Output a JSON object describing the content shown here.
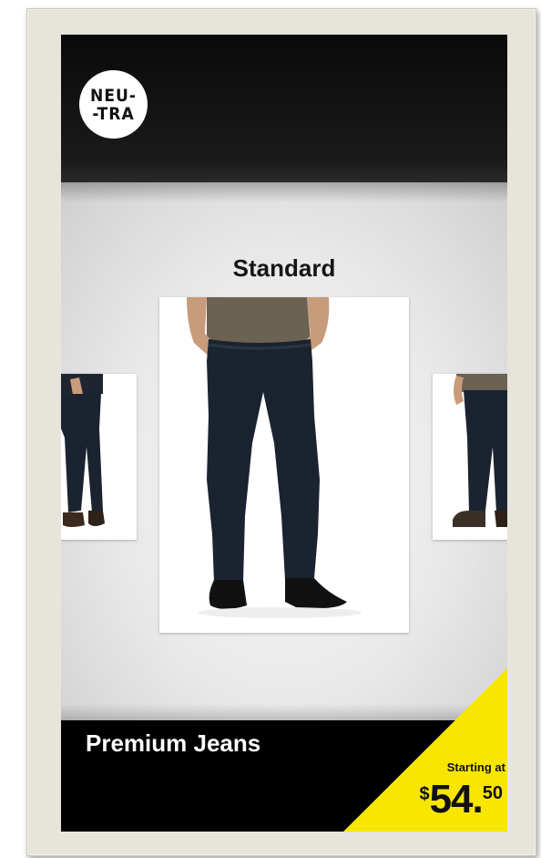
{
  "brand": {
    "logo_line1": "NEU-",
    "logo_line2": "-TRA"
  },
  "carousel": {
    "category_title": "Standard",
    "items": [
      {
        "position": "left",
        "image": "jeans-side-view"
      },
      {
        "position": "center",
        "image": "jeans-front-view"
      },
      {
        "position": "right",
        "image": "jeans-back-view"
      }
    ]
  },
  "product": {
    "name": "Premium Jeans"
  },
  "price": {
    "label": "Starting at",
    "currency": "$",
    "whole": "54",
    "separator": ".",
    "cents": "50"
  },
  "colors": {
    "header_bg": "#0a0a0a",
    "stage_bg": "#e8e8e8",
    "footer_bg": "#000000",
    "price_tag": "#f9e600",
    "bezel": "#e7e4dc",
    "denim": "#1b2330",
    "shirt": "#6b6252",
    "skin": "#c89b7b"
  }
}
